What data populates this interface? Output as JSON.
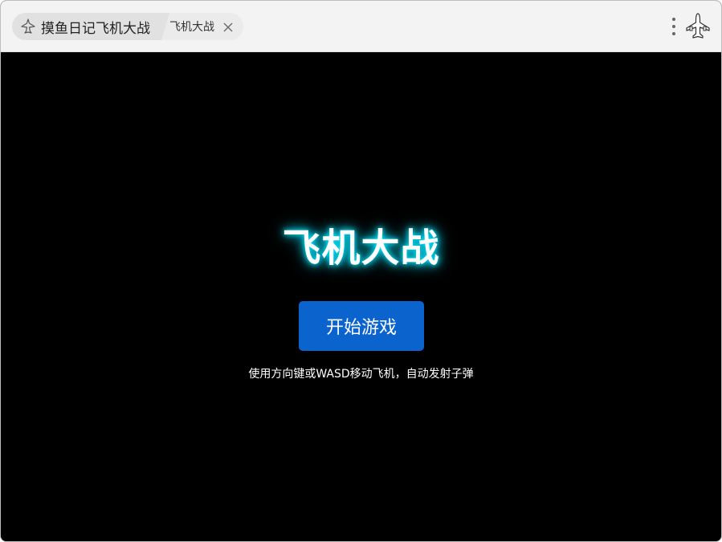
{
  "app": {
    "title": "摸鱼日记飞机大战",
    "icon": "plane-logo-icon"
  },
  "tab": {
    "title": "飞机大战",
    "close_icon": "close-icon"
  },
  "toolbar": {
    "menu_icon": "more-vertical-icon",
    "plane_icon": "airplane-icon"
  },
  "game": {
    "title": "飞机大战",
    "start_label": "开始游戏",
    "instructions": "使用方向键或WASD移动飞机，自动发射子弹",
    "colors": {
      "background": "#000000",
      "button": "#0b63ce",
      "glow": "#00e5ff"
    }
  }
}
